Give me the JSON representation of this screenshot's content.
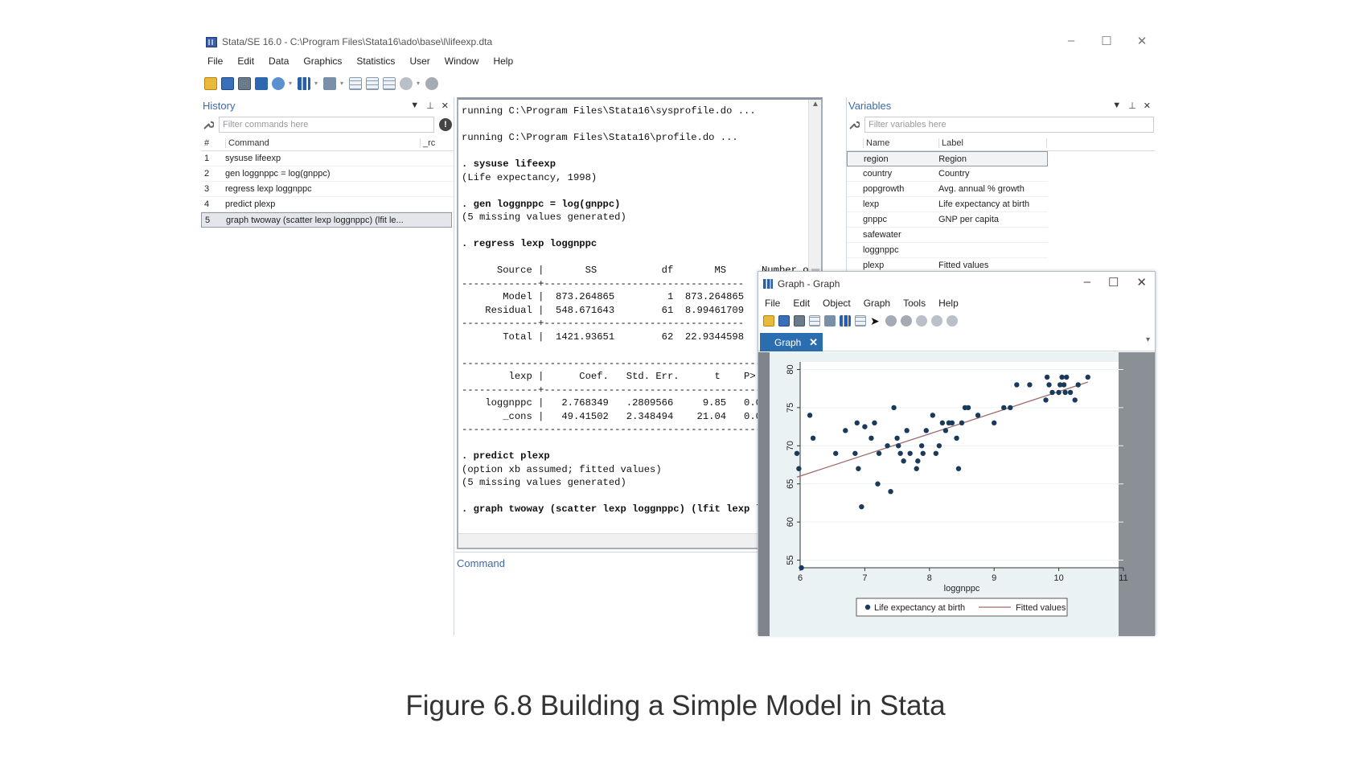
{
  "window": {
    "title": "Stata/SE 16.0 - C:\\Program Files\\Stata16\\ado\\base\\l\\lifeexp.dta",
    "minimize": "–",
    "maximize": "☐",
    "close": "✕"
  },
  "menu": [
    "File",
    "Edit",
    "Data",
    "Graphics",
    "Statistics",
    "User",
    "Window",
    "Help"
  ],
  "history": {
    "title": "History",
    "filter_placeholder": "Filter commands here",
    "col_num": "#",
    "col_command": "Command",
    "col_rc": "_rc",
    "rows": [
      {
        "n": "1",
        "cmd": "sysuse lifeexp"
      },
      {
        "n": "2",
        "cmd": "gen loggnppc = log(gnppc)"
      },
      {
        "n": "3",
        "cmd": "regress lexp loggnppc"
      },
      {
        "n": "4",
        "cmd": "predict plexp"
      },
      {
        "n": "5",
        "cmd": "graph twoway (scatter lexp loggnppc) (lfit le..."
      }
    ]
  },
  "results": {
    "lines": [
      "running C:\\Program Files\\Stata16\\sysprofile.do ...",
      "",
      "running C:\\Program Files\\Stata16\\profile.do ...",
      "",
      ". sysuse lifeexp",
      "(Life expectancy, 1998)",
      "",
      ". gen loggnppc = log(gnppc)",
      "(5 missing values generated)",
      "",
      ". regress lexp loggnppc",
      "",
      "      Source |       SS           df       MS      Number of obs   =",
      "-------------+----------------------------------   F(1, 61)",
      "       Model |  873.264865         1  873.264865   Prob",
      "    Residual |  548.671643        61  8.99461709   R-sq",
      "-------------+----------------------------------   Adj",
      "       Total |  1421.93651        62  22.9344598   Root",
      "",
      "------------------------------------------------------------",
      "        lexp |      Coef.   Std. Err.      t    P>|t|",
      "-------------+----------------------------------------------",
      "    loggnppc |   2.768349   .2809566     9.85   0.000",
      "       _cons |   49.41502   2.348494    21.04   0.000",
      "------------------------------------------------------------",
      "",
      ". predict plexp",
      "(option xb assumed; fitted values)",
      "(5 missing values generated)",
      "",
      ". graph twoway (scatter lexp loggnppc) (lfit lexp loggnppc)",
      "",
      "."
    ]
  },
  "command": {
    "title": "Command"
  },
  "variables": {
    "title": "Variables",
    "filter_placeholder": "Filter variables here",
    "col_name": "Name",
    "col_label": "Label",
    "rows": [
      {
        "name": "region",
        "label": "Region"
      },
      {
        "name": "country",
        "label": "Country"
      },
      {
        "name": "popgrowth",
        "label": "Avg. annual % growth"
      },
      {
        "name": "lexp",
        "label": "Life expectancy at birth"
      },
      {
        "name": "gnppc",
        "label": "GNP per capita"
      },
      {
        "name": "safewater",
        "label": ""
      },
      {
        "name": "loggnppc",
        "label": ""
      },
      {
        "name": "plexp",
        "label": "Fitted values"
      }
    ]
  },
  "graph_window": {
    "title": "Graph - Graph",
    "menu": [
      "File",
      "Edit",
      "Object",
      "Graph",
      "Tools",
      "Help"
    ],
    "tab": "Graph",
    "tab_close": "✕"
  },
  "chart_data": {
    "type": "scatter",
    "xlabel": "loggnppc",
    "ylabel": "",
    "xlim": [
      6,
      11
    ],
    "ylim": [
      54,
      81
    ],
    "xticks": [
      6,
      7,
      8,
      9,
      10,
      11
    ],
    "yticks": [
      55,
      60,
      65,
      70,
      75,
      80
    ],
    "series": [
      {
        "name": "Life expectancy at birth",
        "kind": "scatter",
        "color": "#1a3a5c",
        "points": [
          [
            5.95,
            69
          ],
          [
            5.98,
            67
          ],
          [
            6.02,
            54
          ],
          [
            6.15,
            74
          ],
          [
            6.2,
            71
          ],
          [
            6.55,
            69
          ],
          [
            6.7,
            72
          ],
          [
            6.85,
            69
          ],
          [
            6.88,
            73
          ],
          [
            6.9,
            67
          ],
          [
            6.95,
            62
          ],
          [
            7.0,
            72.5
          ],
          [
            7.1,
            71
          ],
          [
            7.15,
            73
          ],
          [
            7.2,
            65
          ],
          [
            7.22,
            69
          ],
          [
            7.35,
            70
          ],
          [
            7.4,
            64
          ],
          [
            7.45,
            75
          ],
          [
            7.5,
            71
          ],
          [
            7.52,
            70
          ],
          [
            7.55,
            69
          ],
          [
            7.6,
            68
          ],
          [
            7.65,
            72
          ],
          [
            7.7,
            69
          ],
          [
            7.8,
            67
          ],
          [
            7.82,
            68
          ],
          [
            7.88,
            70
          ],
          [
            7.9,
            69
          ],
          [
            7.95,
            72
          ],
          [
            8.05,
            74
          ],
          [
            8.1,
            69
          ],
          [
            8.15,
            70
          ],
          [
            8.2,
            73
          ],
          [
            8.25,
            72
          ],
          [
            8.3,
            73
          ],
          [
            8.35,
            73
          ],
          [
            8.42,
            71
          ],
          [
            8.45,
            67
          ],
          [
            8.5,
            73
          ],
          [
            8.55,
            75
          ],
          [
            8.6,
            75
          ],
          [
            8.75,
            74
          ],
          [
            9.0,
            73
          ],
          [
            9.15,
            75
          ],
          [
            9.25,
            75
          ],
          [
            9.35,
            78
          ],
          [
            9.55,
            78
          ],
          [
            9.8,
            76
          ],
          [
            9.82,
            79
          ],
          [
            9.85,
            78
          ],
          [
            9.9,
            77
          ],
          [
            10.0,
            77
          ],
          [
            10.02,
            78
          ],
          [
            10.05,
            79
          ],
          [
            10.08,
            78
          ],
          [
            10.1,
            77
          ],
          [
            10.12,
            79
          ],
          [
            10.18,
            77
          ],
          [
            10.25,
            76
          ],
          [
            10.3,
            78
          ],
          [
            10.45,
            79
          ]
        ]
      },
      {
        "name": "Fitted values",
        "kind": "line",
        "color": "#9e6a6a",
        "intercept": 49.41502,
        "slope": 2.768349,
        "x_range": [
          5.95,
          10.45
        ]
      }
    ],
    "legend": "bottom"
  },
  "caption": "Figure 6.8 Building a Simple Model in Stata"
}
